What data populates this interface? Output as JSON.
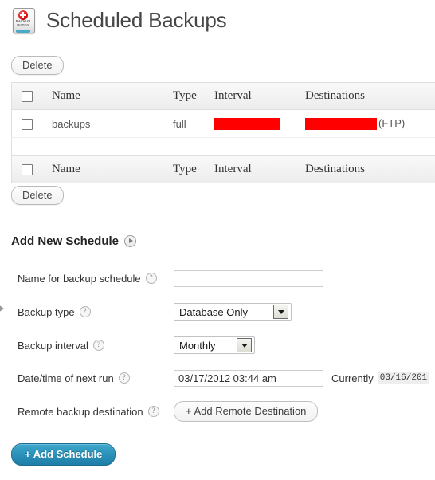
{
  "header": {
    "title": "Scheduled Backups",
    "logo_line1": "BACKUP",
    "logo_line2": "BUDDY"
  },
  "toolbar": {
    "delete_top_label": "Delete",
    "delete_bottom_label": "Delete"
  },
  "table": {
    "columns": [
      "Name",
      "Type",
      "Interval",
      "Destinations"
    ],
    "rows": [
      {
        "name": "backups",
        "type": "full",
        "interval": "",
        "interval_redacted": true,
        "destination": "",
        "destination_redacted": true,
        "destination_suffix": "(FTP)"
      }
    ]
  },
  "add_schedule": {
    "section_title": "Add New Schedule",
    "fields": {
      "name": {
        "label": "Name for backup schedule",
        "value": "",
        "placeholder": ""
      },
      "backup_type": {
        "label": "Backup type",
        "value": "Database Only"
      },
      "backup_interval": {
        "label": "Backup interval",
        "value": "Monthly"
      },
      "next_run": {
        "label": "Date/time of next run",
        "value": "03/17/2012 03:44 am",
        "currently_label": "Currently",
        "currently_value": "03/16/201"
      },
      "remote_destination": {
        "label": "Remote backup destination",
        "button_label": "+ Add Remote Destination"
      }
    },
    "submit_label": "+ Add Schedule"
  },
  "icons": {
    "help": "?"
  },
  "colors": {
    "redaction": "#fe0000",
    "primary_button": "#2d94bb",
    "title_text": "#464646"
  }
}
